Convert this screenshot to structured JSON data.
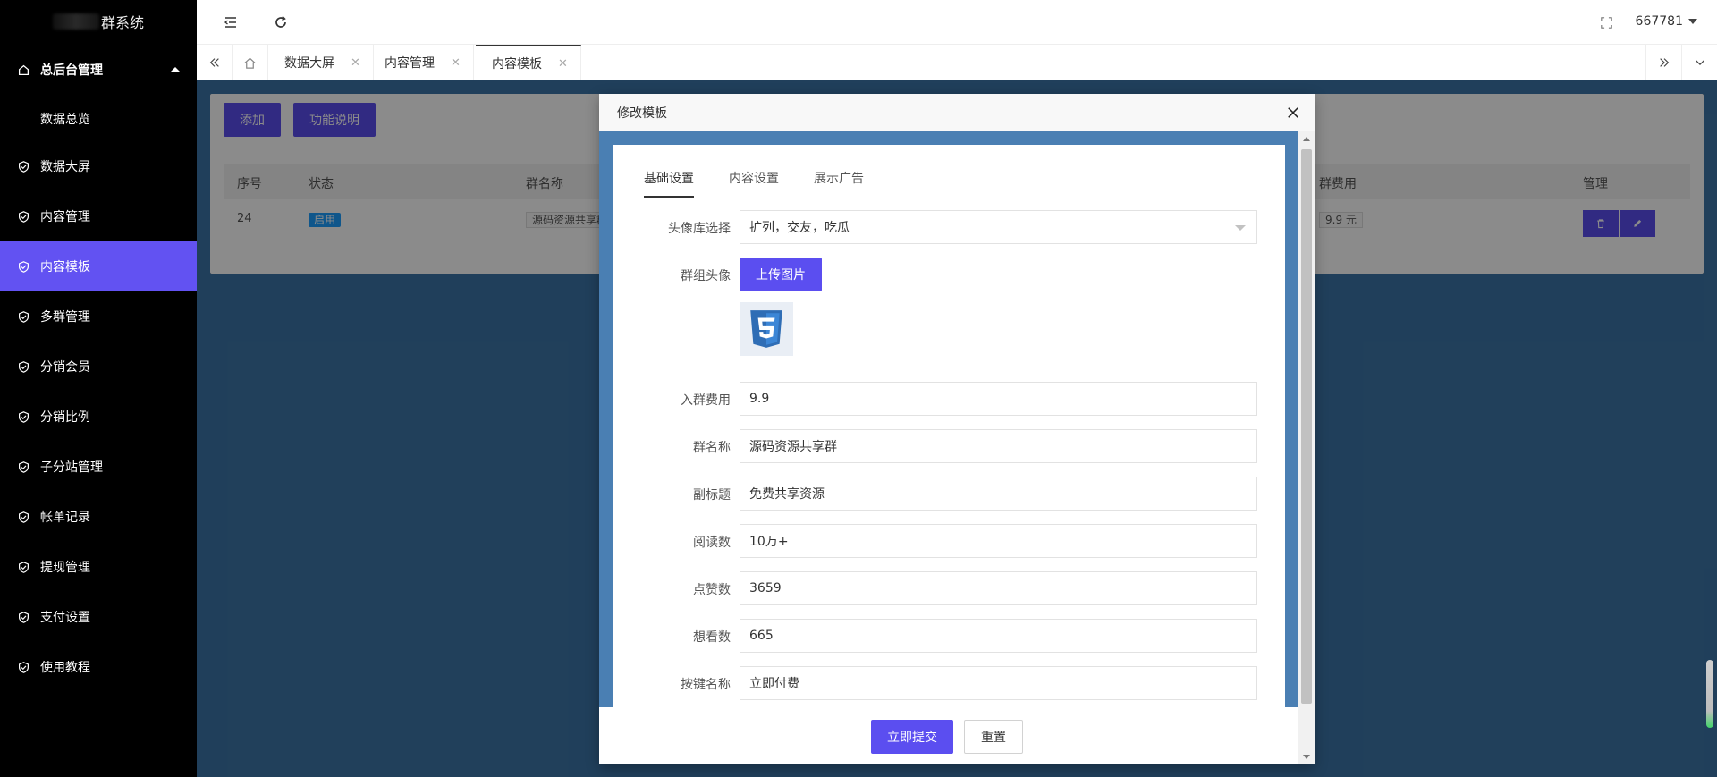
{
  "sidebar": {
    "logo_text": "群系统",
    "section_label": "总后台管理",
    "sub_items": [
      "数据总览"
    ],
    "items": [
      {
        "label": "数据大屏",
        "active": false
      },
      {
        "label": "内容管理",
        "active": false
      },
      {
        "label": "内容模板",
        "active": true
      },
      {
        "label": "多群管理",
        "active": false
      },
      {
        "label": "分销会员",
        "active": false
      },
      {
        "label": "分销比例",
        "active": false
      },
      {
        "label": "子分站管理",
        "active": false
      },
      {
        "label": "帐单记录",
        "active": false
      },
      {
        "label": "提现管理",
        "active": false
      },
      {
        "label": "支付设置",
        "active": false
      },
      {
        "label": "使用教程",
        "active": false
      }
    ]
  },
  "topbar": {
    "user": "667781"
  },
  "tabs": [
    "数据大屏",
    "内容管理",
    "内容模板"
  ],
  "page": {
    "add_button": "添加",
    "help_button": "功能说明",
    "table": {
      "headers": [
        "序号",
        "状态",
        "群名称",
        "群费用",
        "管理"
      ],
      "row": {
        "id": "24",
        "status": "启用",
        "name": "源码资源共享群",
        "fee": "9.9 元"
      }
    }
  },
  "modal": {
    "title": "修改模板",
    "tabs": [
      "基础设置",
      "内容设置",
      "展示广告"
    ],
    "fields": {
      "avatar_lib": {
        "label": "头像库选择",
        "value": "扩列，交友，吃瓜"
      },
      "group_avatar": {
        "label": "群组头像",
        "upload_label": "上传图片"
      },
      "fee": {
        "label": "入群费用",
        "value": "9.9"
      },
      "name": {
        "label": "群名称",
        "value": "源码资源共享群"
      },
      "subtitle": {
        "label": "副标题",
        "value": "免费共享资源"
      },
      "reads": {
        "label": "阅读数",
        "value": "10万+"
      },
      "likes": {
        "label": "点赞数",
        "value": "3659"
      },
      "wants": {
        "label": "想看数",
        "value": "665"
      },
      "button_name": {
        "label": "按键名称",
        "value": "立即付费"
      }
    },
    "submit_label": "立即提交",
    "reset_label": "重置"
  },
  "colors": {
    "accent": "#5b4ef0",
    "active_nav": "#6252f2",
    "badge": "#1e9fff",
    "modal_bg": "#4a7fb3"
  }
}
